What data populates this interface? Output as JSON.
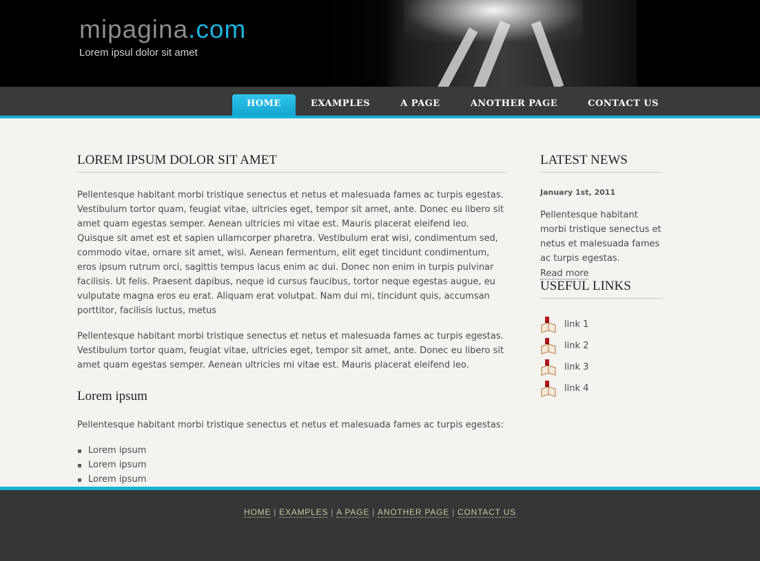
{
  "header": {
    "logo_main": "mipagina",
    "logo_accent": ".com",
    "tagline": "Lorem ipsul dolor sit amet"
  },
  "nav": {
    "items": [
      "HOME",
      "EXAMPLES",
      "A PAGE",
      "ANOTHER PAGE",
      "CONTACT US"
    ],
    "active": "HOME"
  },
  "main": {
    "title": "LOREM IPSUM DOLOR SIT AMET",
    "paragraph1": "Pellentesque habitant morbi tristique senectus et netus et malesuada fames ac turpis egestas. Vestibulum tortor quam, feugiat vitae, ultricies eget, tempor sit amet, ante. Donec eu libero sit amet quam egestas semper. Aenean ultricies mi vitae est. Mauris placerat eleifend leo. Quisque sit amet est et sapien ullamcorper pharetra. Vestibulum erat wisi, condimentum sed, commodo vitae, ornare sit amet, wisi. Aenean fermentum, elit eget tincidunt condimentum, eros ipsum rutrum orci, sagittis tempus lacus enim ac dui. Donec non enim in turpis pulvinar facilisis. Ut felis. Praesent dapibus, neque id cursus faucibus, tortor neque egestas augue, eu vulputate magna eros eu erat. Aliquam erat volutpat. Nam dui mi, tincidunt quis, accumsan porttitor, facilisis luctus, metus",
    "paragraph2": "Pellentesque habitant morbi tristique senectus et netus et malesuada fames ac turpis egestas. Vestibulum tortor quam, feugiat vitae, ultricies eget, tempor sit amet, ante. Donec eu libero sit amet quam egestas semper. Aenean ultricies mi vitae est. Mauris placerat eleifend leo.",
    "subtitle": "Lorem ipsum",
    "paragraph3": "Pellentesque habitant morbi tristique senectus et netus et malesuada fames ac turpis egestas:",
    "list": [
      "Lorem ipsum",
      "Lorem ipsum",
      "Lorem ipsum"
    ]
  },
  "sidebar": {
    "news_title": "LATEST NEWS",
    "news_date": "January 1st, 2011",
    "news_text": "Pellentesque habitant morbi tristique senectus et netus et malesuada fames ac turpis egestas.",
    "read_more": "Read more",
    "links_title": "USEFUL LINKS",
    "links": [
      "link 1",
      "link 2",
      "link 3",
      "link 4"
    ],
    "link_icon": "book-icon"
  },
  "footer": {
    "links": [
      "HOME",
      "EXAMPLES",
      "A PAGE",
      "ANOTHER PAGE",
      "CONTACT US"
    ],
    "separator": "|"
  },
  "colors": {
    "accent": "#17b0d6",
    "header_bg": "#000000",
    "nav_bg": "#3a3a3a",
    "page_bg": "#f4f3f0",
    "footer_bg": "#363636"
  }
}
